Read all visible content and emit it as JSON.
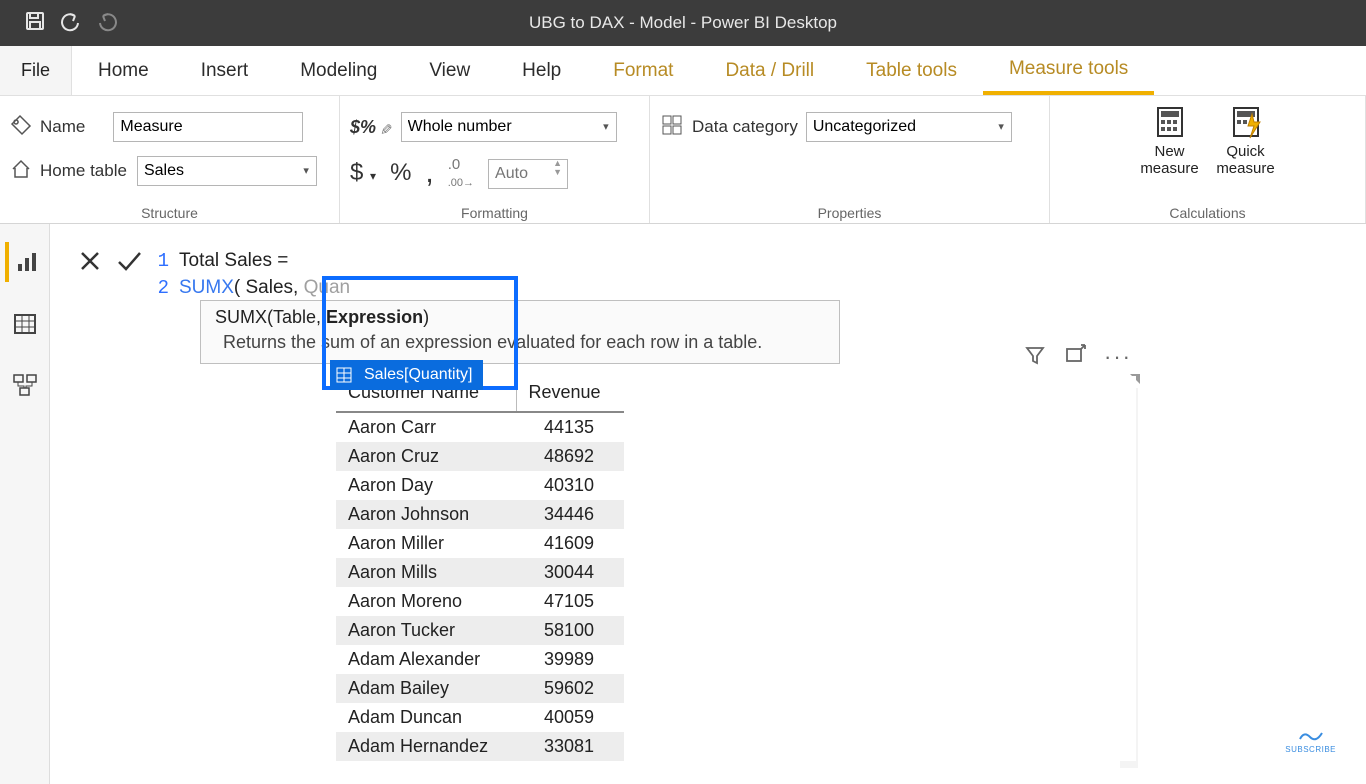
{
  "title": "UBG to DAX - Model - Power BI Desktop",
  "tabs": {
    "file": "File",
    "items": [
      "Home",
      "Insert",
      "Modeling",
      "View",
      "Help"
    ],
    "contextual": [
      "Format",
      "Data / Drill",
      "Table tools",
      "Measure tools"
    ],
    "active": "Measure tools"
  },
  "ribbon": {
    "structure": {
      "label": "Structure",
      "name_label": "Name",
      "name_value": "Measure",
      "home_table_label": "Home table",
      "home_table_value": "Sales"
    },
    "formatting": {
      "label": "Formatting",
      "format_value": "Whole number",
      "auto_placeholder": "Auto",
      "currency": "$",
      "percent": "%",
      "comma": ",",
      "precision": ".00"
    },
    "properties": {
      "label": "Properties",
      "cat_label": "Data category",
      "cat_value": "Uncategorized"
    },
    "calculations": {
      "label": "Calculations",
      "new_measure": "New\nmeasure",
      "quick_measure": "Quick\nmeasure"
    }
  },
  "formula": {
    "line1": "Total Sales =",
    "func": "SUMX",
    "line2_rest": "( Sales,",
    "ghost_input": "Quan",
    "tooltip_sig_pre": "SUMX(Table, ",
    "tooltip_sig_bold": "Expression",
    "tooltip_sig_post": ")",
    "tooltip_desc": "Returns the sum of an expression evaluated for each row in a table.",
    "autocomplete": "Sales[Quantity]"
  },
  "visual": {
    "col1": "Customer Name",
    "col2": "Revenue",
    "rows": [
      {
        "name": "Aaron Carr",
        "rev": "44135"
      },
      {
        "name": "Aaron Cruz",
        "rev": "48692"
      },
      {
        "name": "Aaron Day",
        "rev": "40310"
      },
      {
        "name": "Aaron Johnson",
        "rev": "34446"
      },
      {
        "name": "Aaron Miller",
        "rev": "41609"
      },
      {
        "name": "Aaron Mills",
        "rev": "30044"
      },
      {
        "name": "Aaron Moreno",
        "rev": "47105"
      },
      {
        "name": "Aaron Tucker",
        "rev": "58100"
      },
      {
        "name": "Adam Alexander",
        "rev": "39989"
      },
      {
        "name": "Adam Bailey",
        "rev": "59602"
      },
      {
        "name": "Adam Duncan",
        "rev": "40059"
      },
      {
        "name": "Adam Hernandez",
        "rev": "33081"
      }
    ]
  },
  "subscribe": "SUBSCRIBE"
}
